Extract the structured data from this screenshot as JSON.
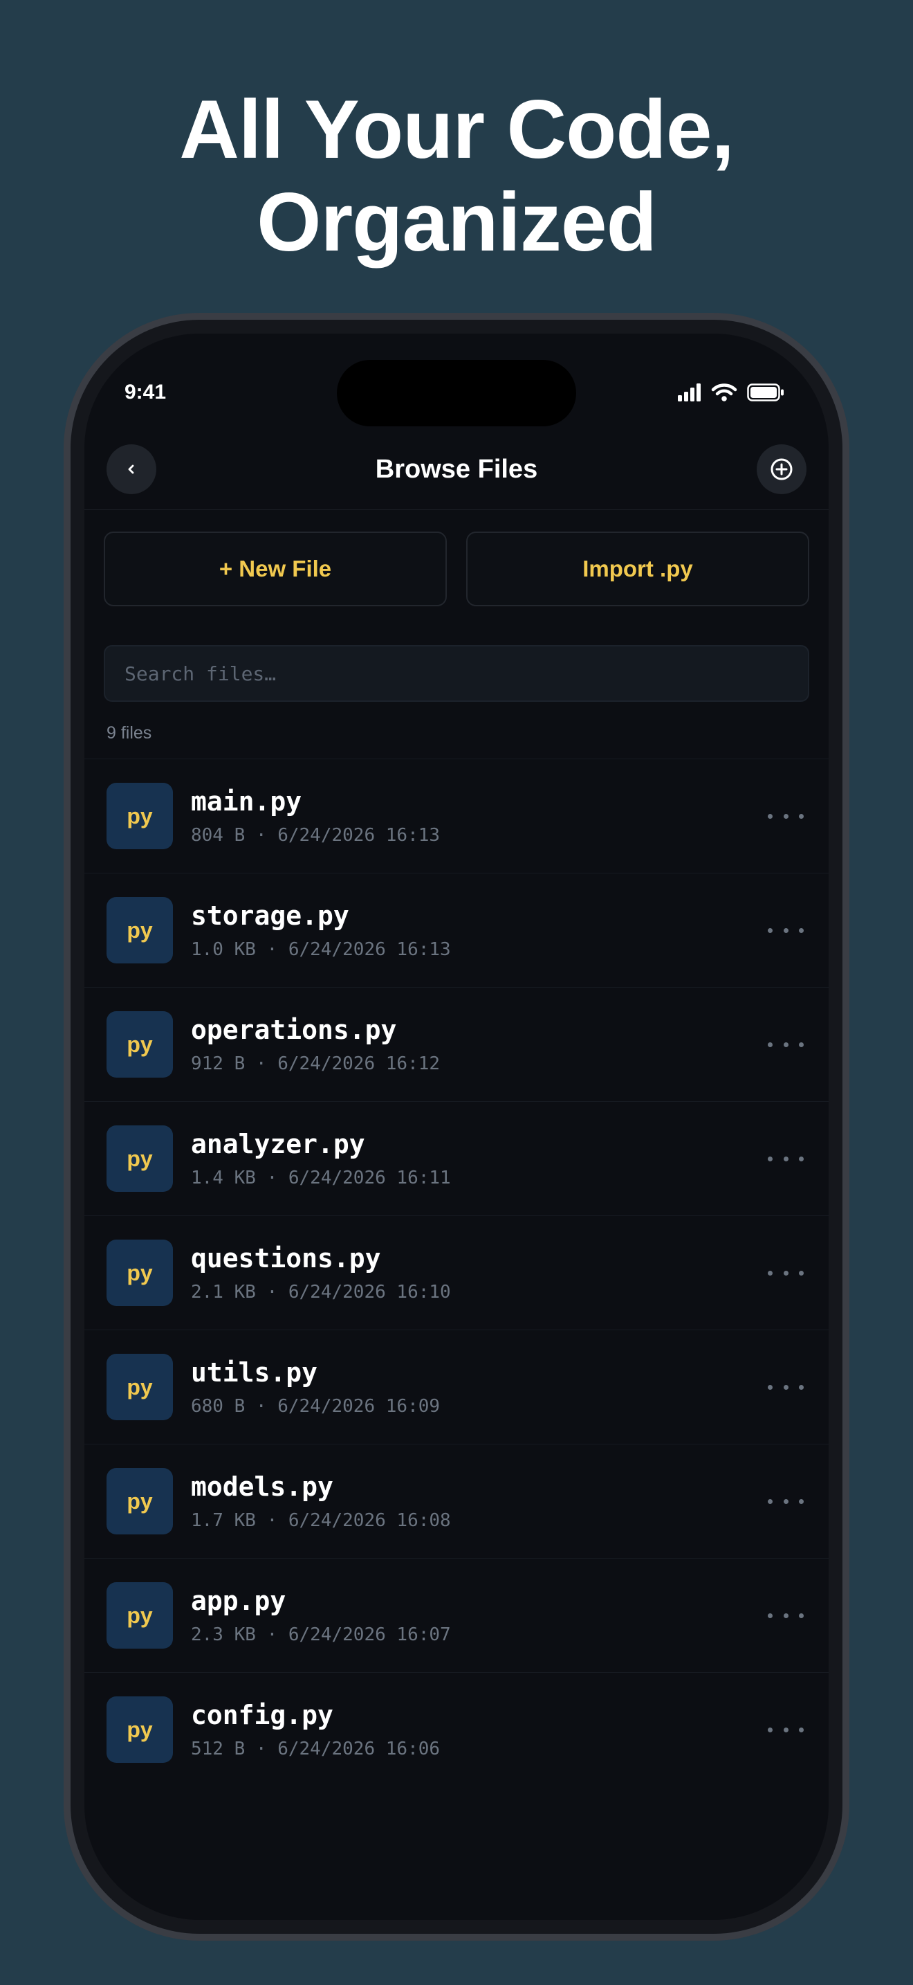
{
  "headline": {
    "line1": "All Your Code,",
    "line2": "Organized"
  },
  "status_bar": {
    "time": "9:41",
    "icons": [
      "cellular-signal-icon",
      "wifi-icon",
      "battery-icon"
    ]
  },
  "nav": {
    "title": "Browse Files",
    "back_icon": "chevron-left-icon",
    "add_icon": "plus-circle-icon"
  },
  "actions": {
    "new_file": "+ New File",
    "import": "Import .py"
  },
  "search": {
    "placeholder": "Search files…"
  },
  "file_count": "9 files",
  "files": [
    {
      "badge": "py",
      "name": "main.py",
      "meta": "804 B · 6/24/2026 16:13"
    },
    {
      "badge": "py",
      "name": "storage.py",
      "meta": "1.0 KB · 6/24/2026 16:13"
    },
    {
      "badge": "py",
      "name": "operations.py",
      "meta": "912 B · 6/24/2026 16:12"
    },
    {
      "badge": "py",
      "name": "analyzer.py",
      "meta": "1.4 KB · 6/24/2026 16:11"
    },
    {
      "badge": "py",
      "name": "questions.py",
      "meta": "2.1 KB · 6/24/2026 16:10"
    },
    {
      "badge": "py",
      "name": "utils.py",
      "meta": "680 B · 6/24/2026 16:09"
    },
    {
      "badge": "py",
      "name": "models.py",
      "meta": "1.7 KB · 6/24/2026 16:08"
    },
    {
      "badge": "py",
      "name": "app.py",
      "meta": "2.3 KB · 6/24/2026 16:07"
    },
    {
      "badge": "py",
      "name": "config.py",
      "meta": "512 B · 6/24/2026 16:06"
    }
  ],
  "colors": {
    "background": "#243d4b",
    "screen": "#0c0e13",
    "accent": "#f1c94f",
    "badge_bg": "#173250",
    "meta_text": "#6b7480"
  }
}
